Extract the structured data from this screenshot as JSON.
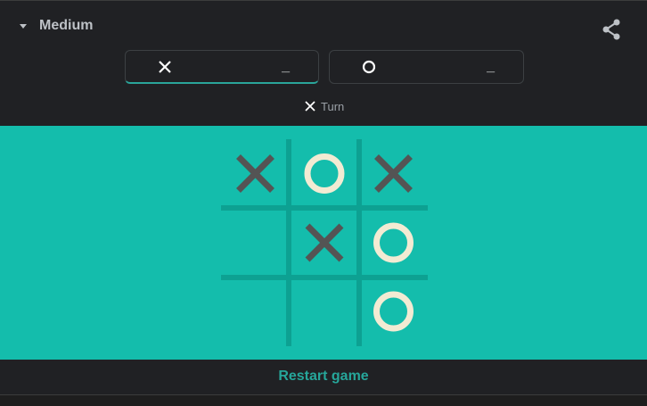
{
  "header": {
    "difficulty": "Medium",
    "share_icon": "share-icon",
    "difficulty_icon": "caret-down-icon"
  },
  "players": [
    {
      "symbol": "X",
      "score": "_"
    },
    {
      "symbol": "O",
      "score": "_"
    }
  ],
  "turn": {
    "symbol": "X",
    "label": "Turn"
  },
  "board": {
    "cells": [
      "X",
      "O",
      "X",
      "",
      "X",
      "O",
      "",
      "",
      "O"
    ],
    "colors": {
      "background": "#14bdac",
      "grid": "#0da192",
      "x_mark": "#545454",
      "o_mark": "#f2ebd3"
    }
  },
  "footer": {
    "restart_label": "Restart game"
  },
  "colors": {
    "accent": "#26a69a",
    "bar": "#202124"
  }
}
